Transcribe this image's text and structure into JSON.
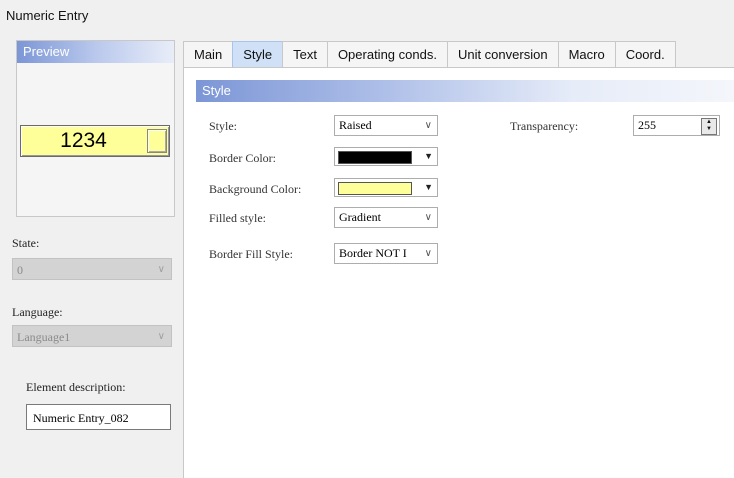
{
  "window": {
    "title": "Numeric Entry"
  },
  "preview": {
    "header": "Preview",
    "value": "1234"
  },
  "left": {
    "state_label": "State:",
    "state_value": "0",
    "language_label": "Language:",
    "language_value": "Language1",
    "description_label": "Element description:",
    "description_value": "Numeric Entry_082"
  },
  "tabs": [
    "Main",
    "Style",
    "Text",
    "Operating conds.",
    "Unit conversion",
    "Macro",
    "Coord."
  ],
  "active_tab": "Style",
  "style": {
    "section": "Style",
    "style_label": "Style:",
    "style_value": "Raised",
    "border_color_label": "Border Color:",
    "border_color": "#000000",
    "background_color_label": "Background Color:",
    "background_color": "#ffff99",
    "filled_style_label": "Filled style:",
    "filled_style_value": "Gradient",
    "border_fill_label": "Border Fill Style:",
    "border_fill_value": "Border NOT I",
    "transparency_label": "Transparency:",
    "transparency_value": "255"
  }
}
